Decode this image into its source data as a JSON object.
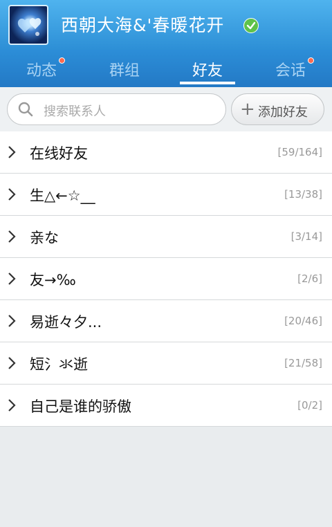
{
  "header": {
    "username": "西朝大海&'春暖花开",
    "avatar_icon": "avatar-image",
    "status_icon": "online-check-icon"
  },
  "tabs": [
    {
      "label": "动态",
      "badge": true,
      "active": false
    },
    {
      "label": "群组",
      "badge": false,
      "active": false
    },
    {
      "label": "好友",
      "badge": false,
      "active": true
    },
    {
      "label": "会话",
      "badge": true,
      "active": false
    }
  ],
  "search": {
    "placeholder": "搜索联系人",
    "add_button_label": "添加好友"
  },
  "groups": [
    {
      "name": "在线好友",
      "count": "[59/164]"
    },
    {
      "name": "生△←☆__",
      "count": "[13/38]"
    },
    {
      "name": "亲な",
      "count": "[3/14]"
    },
    {
      "name": "友→‰",
      "count": "[2/6]"
    },
    {
      "name": "易逝々夕...",
      "count": "[20/46]"
    },
    {
      "name": "短氵氺逝",
      "count": "[21/58]"
    },
    {
      "name": "自己是谁的骄傲",
      "count": "[0/2]"
    }
  ],
  "colors": {
    "header": "#3da2e4",
    "tabs": "#2a86d1",
    "badge": "#ff6a4e",
    "online": "#5fc24a"
  }
}
